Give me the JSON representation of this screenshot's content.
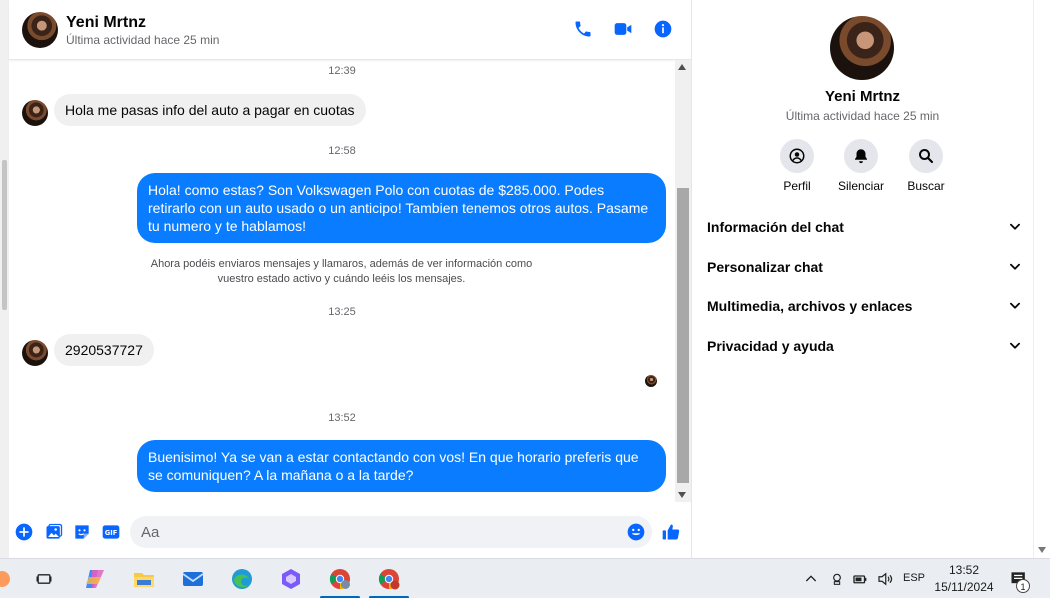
{
  "chat": {
    "contact_name": "Yeni Mrtnz",
    "status": "Última actividad hace 25 min"
  },
  "messages": {
    "time_1": "12:39",
    "in_1": "Hola me pasas info del auto a pagar en cuotas",
    "time_2": "12:58",
    "out_1": "Hola! como estas?  Son Volkswagen Polo con cuotas de $285.000. Podes retirarlo con un auto usado o un anticipo! Tambien tenemos otros autos. Pasame tu numero y te hablamos!",
    "notice": "Ahora podéis enviaros mensajes y llamaros, además de ver información como vuestro estado activo y cuándo leéis los mensajes.",
    "time_3": "13:25",
    "in_2": "2920537727",
    "time_4": "13:52",
    "out_2": "Buenisimo! Ya se van a estar contactando con vos! En que horario preferis que se comuniquen? A la mañana o a la tarde?"
  },
  "composer": {
    "placeholder": "Aa"
  },
  "profile": {
    "name": "Yeni Mrtnz",
    "status": "Última actividad hace 25 min",
    "actions": [
      {
        "label": "Perfil",
        "icon": "profile-icon"
      },
      {
        "label": "Silenciar",
        "icon": "bell-icon"
      },
      {
        "label": "Buscar",
        "icon": "search-icon"
      }
    ],
    "sections": [
      "Información del chat",
      "Personalizar chat",
      "Multimedia, archivos y enlaces",
      "Privacidad y ayuda"
    ]
  },
  "taskbar": {
    "language": "ESP",
    "time": "13:52",
    "date": "15/11/2024",
    "notification_count": "1"
  },
  "colors": {
    "accent": "#0a7cff",
    "icon_blue": "#0866ff",
    "incoming_bubble": "#f0f0f0",
    "taskbar": "#eaeef3"
  }
}
